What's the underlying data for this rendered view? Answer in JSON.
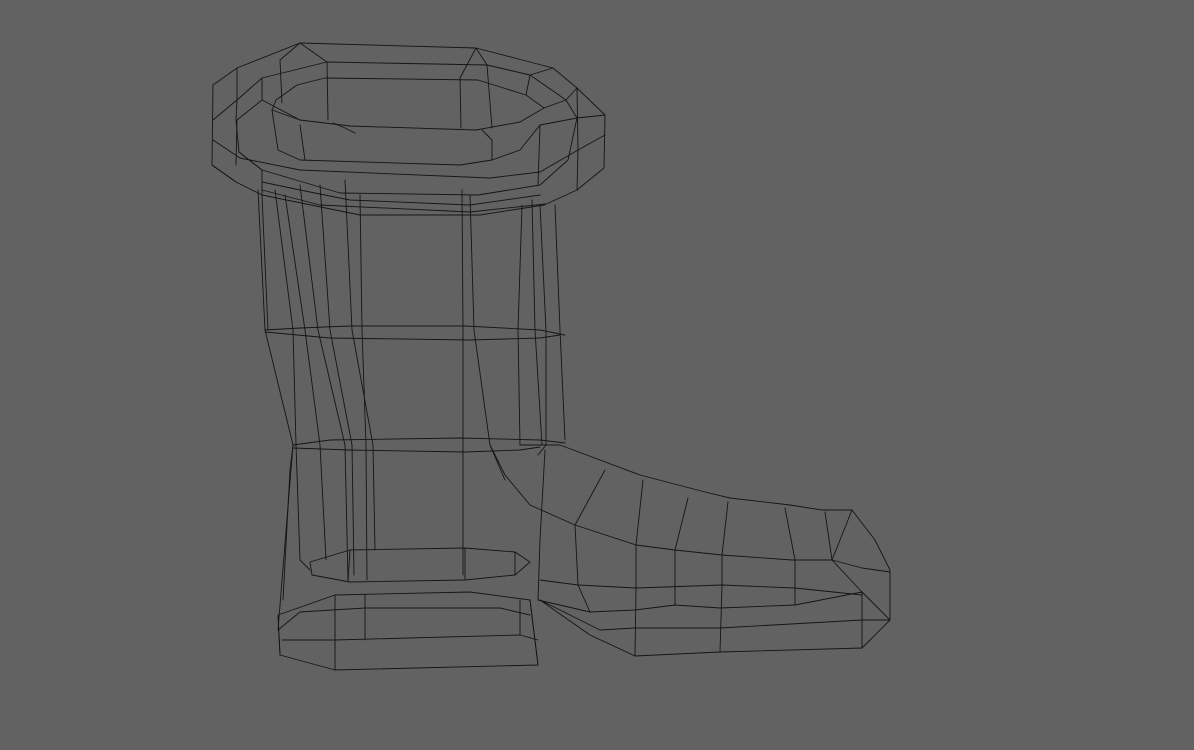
{
  "viewport": {
    "background_color": "#626262",
    "wire_color": "#151515",
    "display_mode": "wireframe",
    "object": "boot mesh"
  }
}
